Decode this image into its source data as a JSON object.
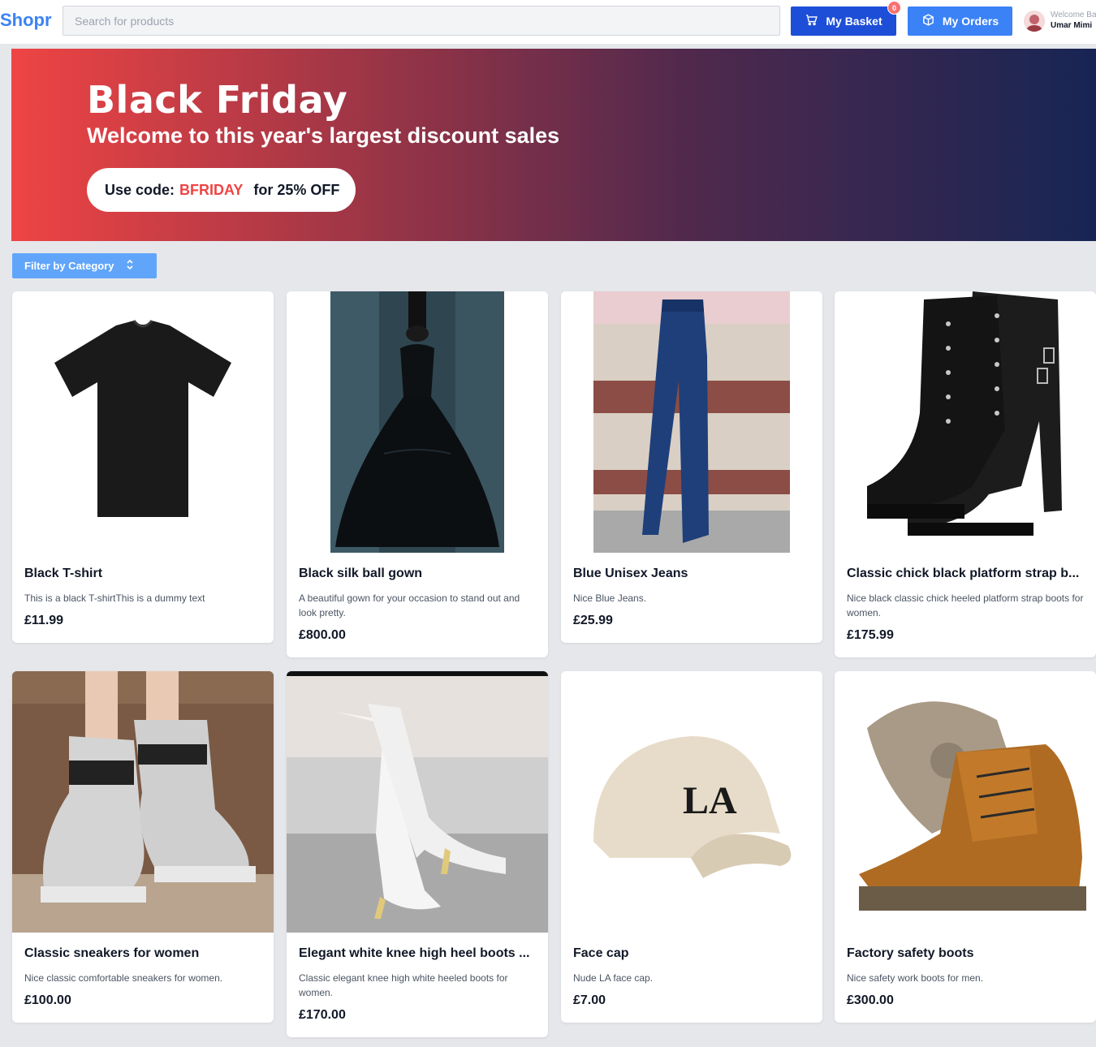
{
  "header": {
    "logo": "Shopr",
    "search_placeholder": "Search for products",
    "basket_label": "My Basket",
    "basket_count": "0",
    "orders_label": "My Orders",
    "welcome_label": "Welcome Back",
    "user_name": "Umar Mimi"
  },
  "hero": {
    "title": "Black Friday",
    "subtitle": "Welcome to this year's largest discount sales",
    "code_prefix": "Use code:",
    "code": "BFRIDAY",
    "code_suffix": "for 25% OFF"
  },
  "filter": {
    "label": "Filter by Category"
  },
  "products": [
    {
      "title": "Black T-shirt",
      "description": "This is a black T-shirtThis is a dummy text",
      "price": "£11.99",
      "image": "black-tshirt"
    },
    {
      "title": "Black silk ball gown",
      "description": "A beautiful gown for your occasion to stand out and look pretty.",
      "price": "£800.00",
      "image": "ball-gown"
    },
    {
      "title": "Blue Unisex Jeans",
      "description": "Nice Blue Jeans.",
      "price": "£25.99",
      "image": "blue-jeans"
    },
    {
      "title": "Classic chick black platform strap b...",
      "description": "Nice black classic chick heeled platform strap boots for women.",
      "price": "£175.99",
      "image": "platform-boots"
    },
    {
      "title": "Classic sneakers for women",
      "description": "Nice classic comfortable sneakers for women.",
      "price": "£100.00",
      "image": "sneakers"
    },
    {
      "title": "Elegant white knee high heel boots ...",
      "description": "Classic elegant knee high white heeled boots for women.",
      "price": "£170.00",
      "image": "white-boots"
    },
    {
      "title": "Face cap",
      "description": "Nude LA face cap.",
      "price": "£7.00",
      "image": "face-cap"
    },
    {
      "title": "Factory safety boots",
      "description": "Nice safety work boots for men.",
      "price": "£300.00",
      "image": "safety-boots"
    }
  ]
}
